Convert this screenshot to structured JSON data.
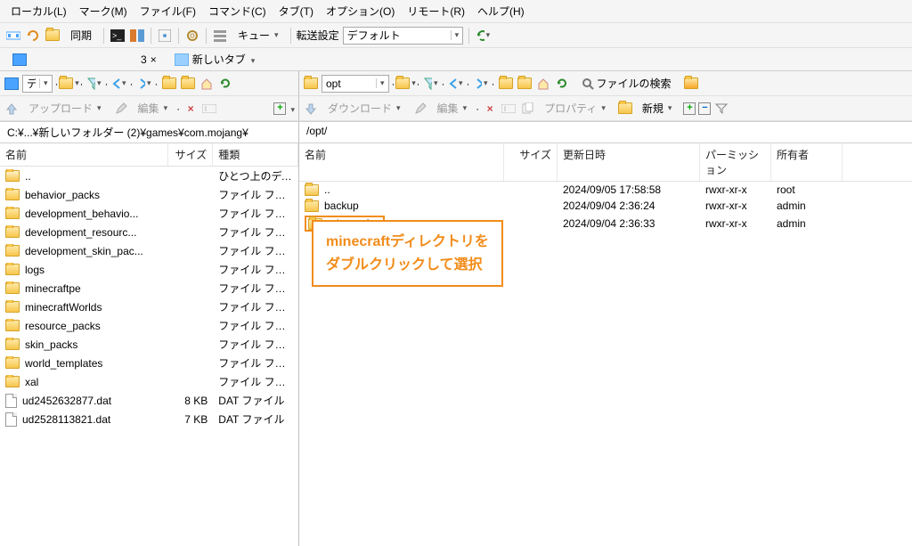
{
  "menubar": [
    "ローカル(L)",
    "マーク(M)",
    "ファイル(F)",
    "コマンド(C)",
    "タブ(T)",
    "オプション(O)",
    "リモート(R)",
    "ヘルプ(H)"
  ],
  "toolbar1": {
    "sync": "同期",
    "queue": "キュー",
    "transfer_label": "転送設定",
    "transfer_value": "デフォルト"
  },
  "tabs": {
    "session_short": "3",
    "newtab": "新しいタブ"
  },
  "panetool": {
    "local_drive": "デ",
    "remote_drive": "opt",
    "find": "ファイルの検索"
  },
  "actionbar": {
    "upload": "アップロード",
    "edit": "編集",
    "download": "ダウンロード",
    "edit2": "編集",
    "properties": "プロパティ",
    "new": "新規"
  },
  "paths": {
    "local": "C:¥...¥新しいフォルダー (2)¥games¥com.mojang¥",
    "remote": "/opt/"
  },
  "local": {
    "cols": {
      "name": "名前",
      "size": "サイズ",
      "type": "種類"
    },
    "col_w": {
      "name": 190,
      "size": 50,
      "type": 96
    },
    "rows": [
      {
        "name": "..",
        "size": "",
        "type": "ひとつ上のディレク",
        "kind": "up"
      },
      {
        "name": "behavior_packs",
        "size": "",
        "type": "ファイル フォルダー",
        "kind": "folder"
      },
      {
        "name": "development_behavio...",
        "size": "",
        "type": "ファイル フォルダー",
        "kind": "folder"
      },
      {
        "name": "development_resourc...",
        "size": "",
        "type": "ファイル フォルダー",
        "kind": "folder"
      },
      {
        "name": "development_skin_pac...",
        "size": "",
        "type": "ファイル フォルダー",
        "kind": "folder"
      },
      {
        "name": "logs",
        "size": "",
        "type": "ファイル フォルダー",
        "kind": "folder"
      },
      {
        "name": "minecraftpe",
        "size": "",
        "type": "ファイル フォルダー",
        "kind": "folder"
      },
      {
        "name": "minecraftWorlds",
        "size": "",
        "type": "ファイル フォルダー",
        "kind": "folder"
      },
      {
        "name": "resource_packs",
        "size": "",
        "type": "ファイル フォルダー",
        "kind": "folder"
      },
      {
        "name": "skin_packs",
        "size": "",
        "type": "ファイル フォルダー",
        "kind": "folder"
      },
      {
        "name": "world_templates",
        "size": "",
        "type": "ファイル フォルダー",
        "kind": "folder"
      },
      {
        "name": "xal",
        "size": "",
        "type": "ファイル フォルダー",
        "kind": "folder"
      },
      {
        "name": "ud2452632877.dat",
        "size": "8 KB",
        "type": "DAT ファイル",
        "kind": "file"
      },
      {
        "name": "ud2528113821.dat",
        "size": "7 KB",
        "type": "DAT ファイル",
        "kind": "file"
      }
    ]
  },
  "remote": {
    "cols": {
      "name": "名前",
      "size": "サイズ",
      "date": "更新日時",
      "perm": "パーミッション",
      "owner": "所有者"
    },
    "col_w": {
      "name": 230,
      "size": 60,
      "date": 160,
      "perm": 80,
      "owner": 80
    },
    "rows": [
      {
        "name": "..",
        "size": "",
        "date": "2024/09/05 17:58:58",
        "perm": "rwxr-xr-x",
        "owner": "root",
        "kind": "up"
      },
      {
        "name": "backup",
        "size": "",
        "date": "2024/09/04 2:36:24",
        "perm": "rwxr-xr-x",
        "owner": "admin",
        "kind": "folder"
      },
      {
        "name": "minecraft",
        "size": "",
        "date": "2024/09/04 2:36:33",
        "perm": "rwxr-xr-x",
        "owner": "admin",
        "kind": "folder",
        "highlight": true
      }
    ]
  },
  "callout": {
    "line1": "minecraftディレクトリを",
    "line2": "ダブルクリックして選択"
  }
}
